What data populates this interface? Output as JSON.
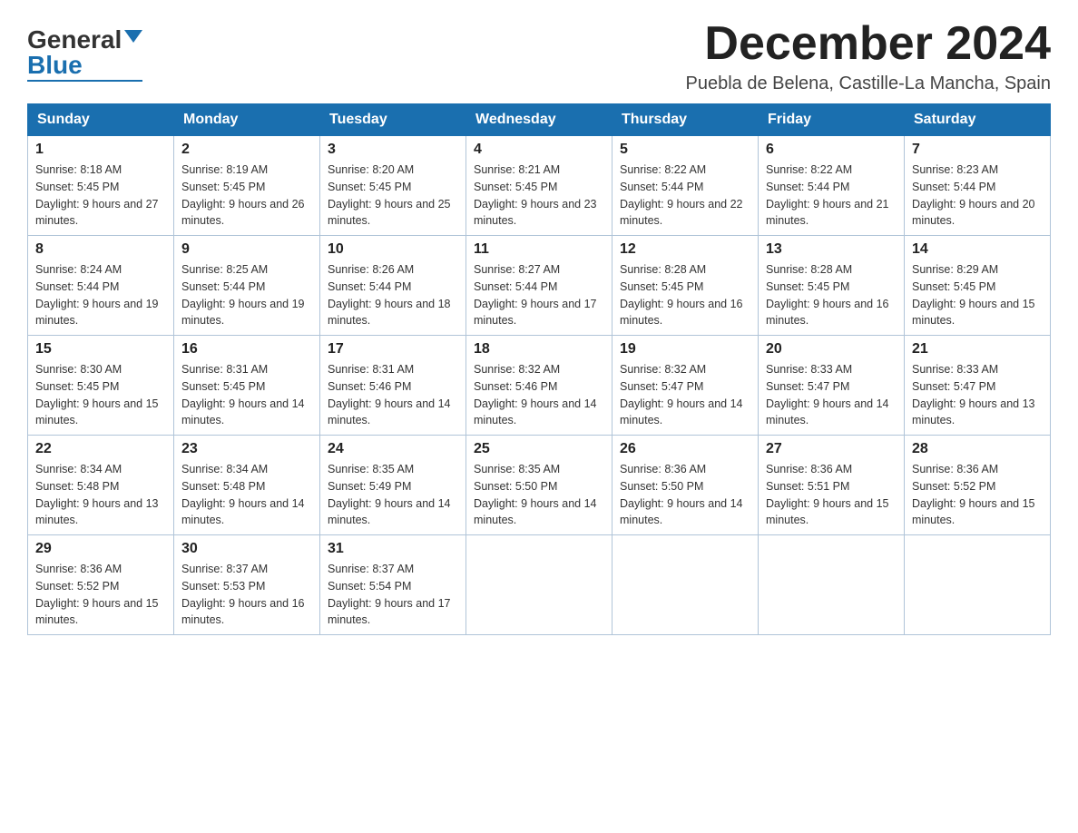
{
  "logo": {
    "general": "General",
    "blue": "Blue"
  },
  "header": {
    "month_year": "December 2024",
    "location": "Puebla de Belena, Castille-La Mancha, Spain"
  },
  "weekdays": [
    "Sunday",
    "Monday",
    "Tuesday",
    "Wednesday",
    "Thursday",
    "Friday",
    "Saturday"
  ],
  "weeks": [
    [
      {
        "day": "1",
        "sunrise": "8:18 AM",
        "sunset": "5:45 PM",
        "daylight": "9 hours and 27 minutes."
      },
      {
        "day": "2",
        "sunrise": "8:19 AM",
        "sunset": "5:45 PM",
        "daylight": "9 hours and 26 minutes."
      },
      {
        "day": "3",
        "sunrise": "8:20 AM",
        "sunset": "5:45 PM",
        "daylight": "9 hours and 25 minutes."
      },
      {
        "day": "4",
        "sunrise": "8:21 AM",
        "sunset": "5:45 PM",
        "daylight": "9 hours and 23 minutes."
      },
      {
        "day": "5",
        "sunrise": "8:22 AM",
        "sunset": "5:44 PM",
        "daylight": "9 hours and 22 minutes."
      },
      {
        "day": "6",
        "sunrise": "8:22 AM",
        "sunset": "5:44 PM",
        "daylight": "9 hours and 21 minutes."
      },
      {
        "day": "7",
        "sunrise": "8:23 AM",
        "sunset": "5:44 PM",
        "daylight": "9 hours and 20 minutes."
      }
    ],
    [
      {
        "day": "8",
        "sunrise": "8:24 AM",
        "sunset": "5:44 PM",
        "daylight": "9 hours and 19 minutes."
      },
      {
        "day": "9",
        "sunrise": "8:25 AM",
        "sunset": "5:44 PM",
        "daylight": "9 hours and 19 minutes."
      },
      {
        "day": "10",
        "sunrise": "8:26 AM",
        "sunset": "5:44 PM",
        "daylight": "9 hours and 18 minutes."
      },
      {
        "day": "11",
        "sunrise": "8:27 AM",
        "sunset": "5:44 PM",
        "daylight": "9 hours and 17 minutes."
      },
      {
        "day": "12",
        "sunrise": "8:28 AM",
        "sunset": "5:45 PM",
        "daylight": "9 hours and 16 minutes."
      },
      {
        "day": "13",
        "sunrise": "8:28 AM",
        "sunset": "5:45 PM",
        "daylight": "9 hours and 16 minutes."
      },
      {
        "day": "14",
        "sunrise": "8:29 AM",
        "sunset": "5:45 PM",
        "daylight": "9 hours and 15 minutes."
      }
    ],
    [
      {
        "day": "15",
        "sunrise": "8:30 AM",
        "sunset": "5:45 PM",
        "daylight": "9 hours and 15 minutes."
      },
      {
        "day": "16",
        "sunrise": "8:31 AM",
        "sunset": "5:45 PM",
        "daylight": "9 hours and 14 minutes."
      },
      {
        "day": "17",
        "sunrise": "8:31 AM",
        "sunset": "5:46 PM",
        "daylight": "9 hours and 14 minutes."
      },
      {
        "day": "18",
        "sunrise": "8:32 AM",
        "sunset": "5:46 PM",
        "daylight": "9 hours and 14 minutes."
      },
      {
        "day": "19",
        "sunrise": "8:32 AM",
        "sunset": "5:47 PM",
        "daylight": "9 hours and 14 minutes."
      },
      {
        "day": "20",
        "sunrise": "8:33 AM",
        "sunset": "5:47 PM",
        "daylight": "9 hours and 14 minutes."
      },
      {
        "day": "21",
        "sunrise": "8:33 AM",
        "sunset": "5:47 PM",
        "daylight": "9 hours and 13 minutes."
      }
    ],
    [
      {
        "day": "22",
        "sunrise": "8:34 AM",
        "sunset": "5:48 PM",
        "daylight": "9 hours and 13 minutes."
      },
      {
        "day": "23",
        "sunrise": "8:34 AM",
        "sunset": "5:48 PM",
        "daylight": "9 hours and 14 minutes."
      },
      {
        "day": "24",
        "sunrise": "8:35 AM",
        "sunset": "5:49 PM",
        "daylight": "9 hours and 14 minutes."
      },
      {
        "day": "25",
        "sunrise": "8:35 AM",
        "sunset": "5:50 PM",
        "daylight": "9 hours and 14 minutes."
      },
      {
        "day": "26",
        "sunrise": "8:36 AM",
        "sunset": "5:50 PM",
        "daylight": "9 hours and 14 minutes."
      },
      {
        "day": "27",
        "sunrise": "8:36 AM",
        "sunset": "5:51 PM",
        "daylight": "9 hours and 15 minutes."
      },
      {
        "day": "28",
        "sunrise": "8:36 AM",
        "sunset": "5:52 PM",
        "daylight": "9 hours and 15 minutes."
      }
    ],
    [
      {
        "day": "29",
        "sunrise": "8:36 AM",
        "sunset": "5:52 PM",
        "daylight": "9 hours and 15 minutes."
      },
      {
        "day": "30",
        "sunrise": "8:37 AM",
        "sunset": "5:53 PM",
        "daylight": "9 hours and 16 minutes."
      },
      {
        "day": "31",
        "sunrise": "8:37 AM",
        "sunset": "5:54 PM",
        "daylight": "9 hours and 17 minutes."
      },
      null,
      null,
      null,
      null
    ]
  ]
}
